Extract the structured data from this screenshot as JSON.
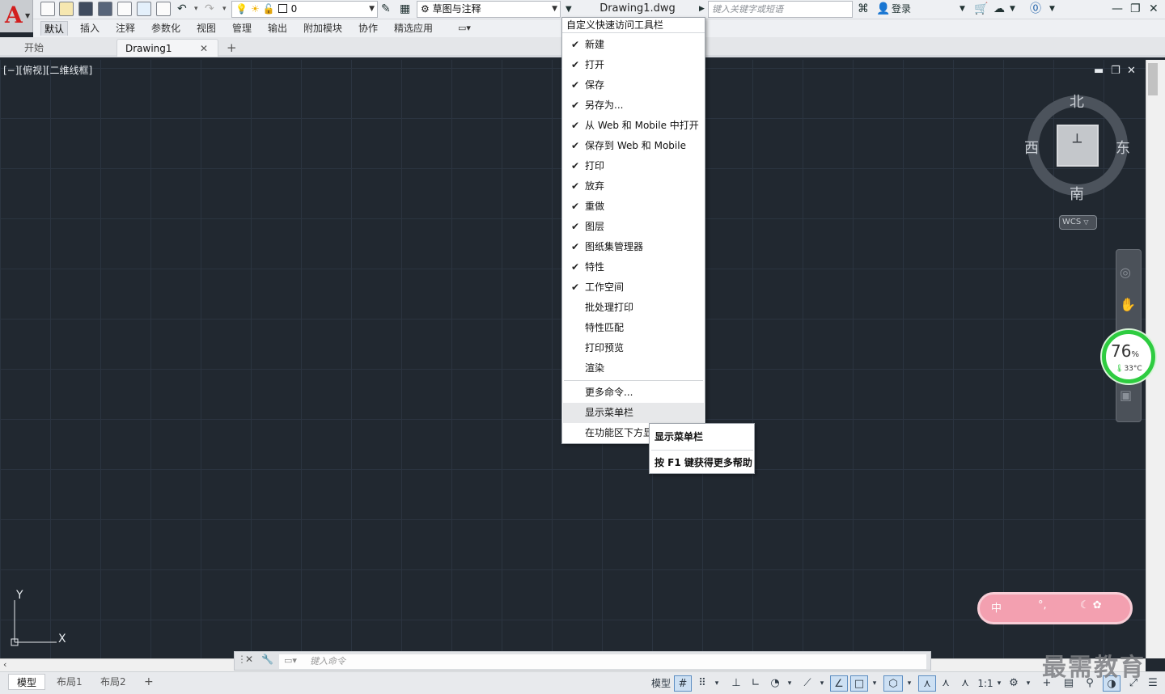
{
  "app": {
    "logo_letter": "A"
  },
  "qat": {
    "layer_value": "0",
    "workspace": "草图与注释",
    "doc_title": "Drawing1.dwg",
    "search_placeholder": "键入关键字或短语",
    "login": "登录"
  },
  "ribbon_tabs": [
    "默认",
    "插入",
    "注释",
    "参数化",
    "视图",
    "管理",
    "输出",
    "附加模块",
    "协作",
    "精选应用"
  ],
  "file_tabs": [
    "开始",
    "Drawing1"
  ],
  "viewport": {
    "label": "[−][俯视][二维线框]",
    "compass": {
      "north": "北",
      "south": "南",
      "east": "东",
      "west": "西"
    },
    "wcs": "WCS",
    "ucs_x": "X",
    "ucs_y": "Y"
  },
  "gauge": {
    "value": "76",
    "unit": "%",
    "temp": "33°C"
  },
  "pink_widget": {
    "char1": "中",
    "char2": "°,",
    "char3": "☾ ✿"
  },
  "command": {
    "placeholder": "键入命令"
  },
  "layout_tabs": [
    "模型",
    "布局1",
    "布局2"
  ],
  "status": {
    "model": "模型",
    "scale": "1:1"
  },
  "menu": {
    "title": "自定义快速访问工具栏",
    "items": [
      {
        "label": "新建",
        "checked": true
      },
      {
        "label": "打开",
        "checked": true
      },
      {
        "label": "保存",
        "checked": true
      },
      {
        "label": "另存为...",
        "checked": true
      },
      {
        "label": "从 Web 和 Mobile 中打开",
        "checked": true
      },
      {
        "label": "保存到 Web 和 Mobile",
        "checked": true
      },
      {
        "label": "打印",
        "checked": true
      },
      {
        "label": "放弃",
        "checked": true
      },
      {
        "label": "重做",
        "checked": true
      },
      {
        "label": "图层",
        "checked": true
      },
      {
        "label": "图纸集管理器",
        "checked": true
      },
      {
        "label": "特性",
        "checked": true
      },
      {
        "label": "工作空间",
        "checked": true
      },
      {
        "label": "批处理打印",
        "checked": false
      },
      {
        "label": "特性匹配",
        "checked": false
      },
      {
        "label": "打印预览",
        "checked": false
      },
      {
        "label": "渲染",
        "checked": false
      }
    ],
    "more": "更多命令...",
    "show_menubar": "显示菜单栏",
    "below_ribbon": "在功能区下方显示"
  },
  "tooltip": {
    "title": "显示菜单栏",
    "help": "按 F1 键获得更多帮助"
  },
  "watermark": "最需教育"
}
